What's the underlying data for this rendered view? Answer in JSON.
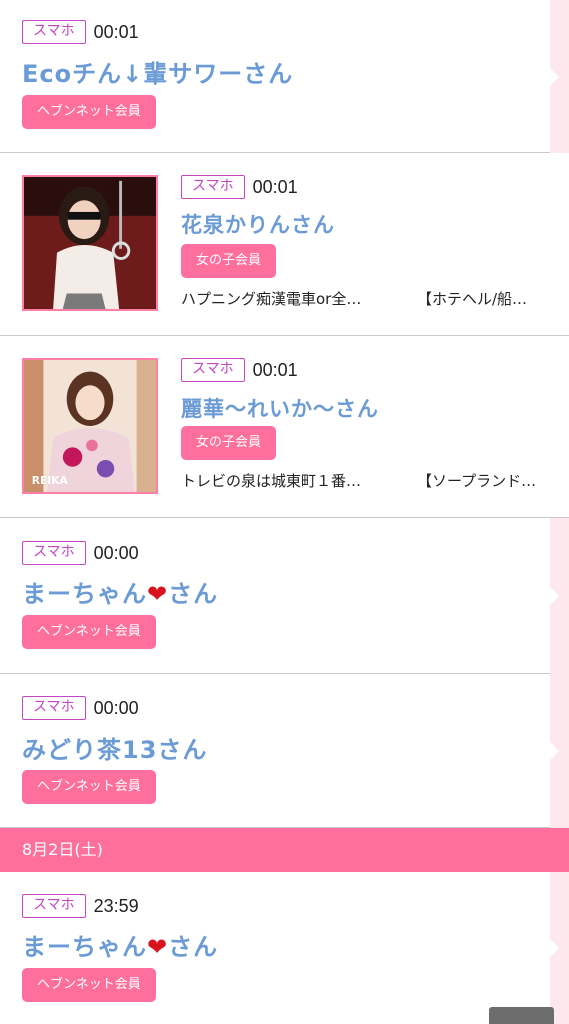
{
  "entries": [
    {
      "device": "スマホ",
      "time": "00:01",
      "name": "Ecoチん↓輩サワーさん",
      "member": "ヘブンネット会員"
    },
    {
      "device": "スマホ",
      "time": "00:01",
      "name": "花泉かりんさん",
      "member": "女の子会員",
      "desc_left": "ハプニング痴漢電車or全…",
      "desc_right": "【ホテヘル/船…"
    },
    {
      "device": "スマホ",
      "time": "00:01",
      "name": "麗華〜れいか〜さん",
      "member": "女の子会員",
      "desc_left": "トレビの泉は城東町１番…",
      "desc_right": "【ソープランド…",
      "thumb_caption": "REIKA"
    },
    {
      "device": "スマホ",
      "time": "00:00",
      "name_prefix": "まーちゃん",
      "name_heart": "❤",
      "name_suffix": "さん",
      "member": "ヘブンネット会員"
    },
    {
      "device": "スマホ",
      "time": "00:00",
      "name": "みどり茶13さん",
      "member": "ヘブンネット会員"
    },
    {
      "device": "スマホ",
      "time": "23:59",
      "name_prefix": "まーちゃん",
      "name_heart": "❤",
      "name_suffix": "さん",
      "member": "ヘブンネット会員"
    }
  ],
  "date_header": "8月2日(土)",
  "colors": {
    "accent_pink": "#ff6f9d",
    "name_blue": "#6b9bd6",
    "badge_purple": "#c546c5",
    "strip": "#fde8ee"
  }
}
